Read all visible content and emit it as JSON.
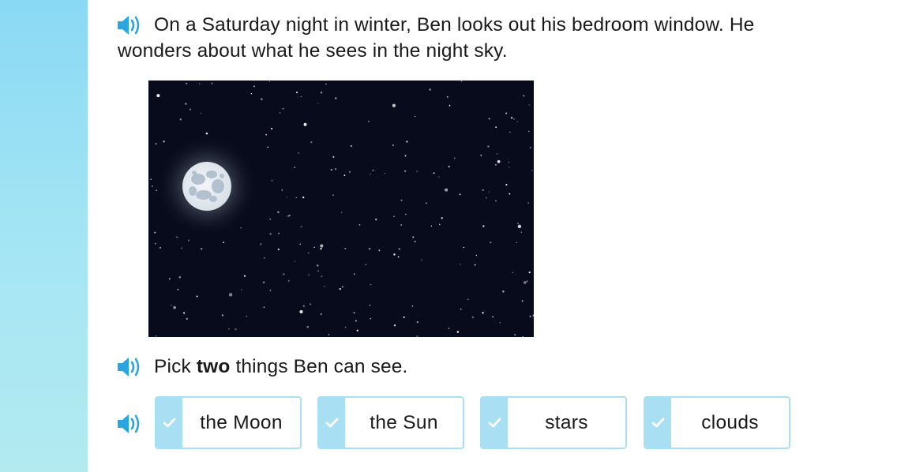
{
  "question": {
    "line1": "On a Saturday night in winter, Ben looks out his bedroom window. He",
    "line2": "wonders about what he sees in the night sky."
  },
  "image": {
    "subject_icons": [
      "moon",
      "stars",
      "night-sky"
    ]
  },
  "prompt": {
    "before": "Pick ",
    "emphasis": "two",
    "after": " things Ben can see."
  },
  "choices": [
    {
      "label": "the Moon",
      "selected": false
    },
    {
      "label": "the Sun",
      "selected": false
    },
    {
      "label": "stars",
      "selected": false
    },
    {
      "label": "clouds",
      "selected": false
    }
  ],
  "icons": {
    "audio": "speaker-icon",
    "check": "check-icon"
  },
  "colors": {
    "sidebar_top": "#8ad9f4",
    "sidebar_bottom": "#b2eaf0",
    "speaker_blue": "#29a6e0",
    "choice_border": "#a9dff2",
    "night_sky": "#080b1c"
  }
}
